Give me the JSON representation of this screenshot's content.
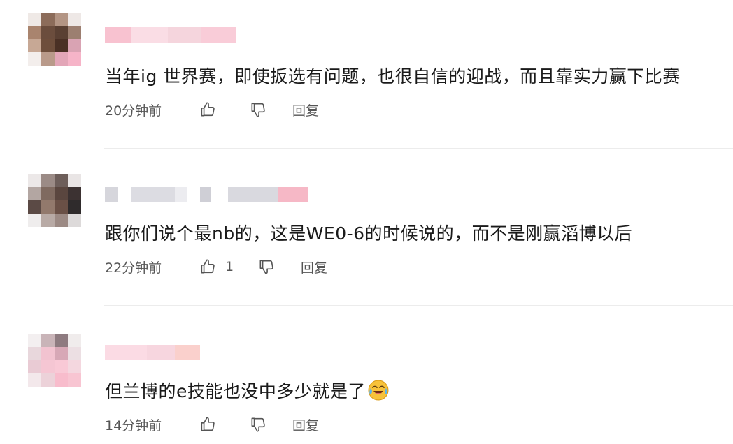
{
  "comments": [
    {
      "text": "当年ig 世界赛，即使扳选有问题，也很自信的迎战，而且靠实力赢下比赛",
      "time": "20分钟前",
      "like_count": "",
      "reply_label": "回复"
    },
    {
      "text": "跟你们说个最nb的，这是WE0-6的时候说的，而不是刚赢滔博以后",
      "time": "22分钟前",
      "like_count": "1",
      "reply_label": "回复"
    },
    {
      "text": "但兰博的e技能也没中多少就是了",
      "time": "14分钟前",
      "like_count": "",
      "reply_label": "回复"
    }
  ],
  "icons": {
    "like": "thumbs-up-icon",
    "dislike": "thumbs-down-icon",
    "emoji": "crying-laughing-emoji-icon"
  },
  "colors": {
    "text": "#1a1a1a",
    "meta": "#555555",
    "divider": "#ececec",
    "blur_pink": "#f6b7c9",
    "blur_gray": "#d4d4d8"
  }
}
